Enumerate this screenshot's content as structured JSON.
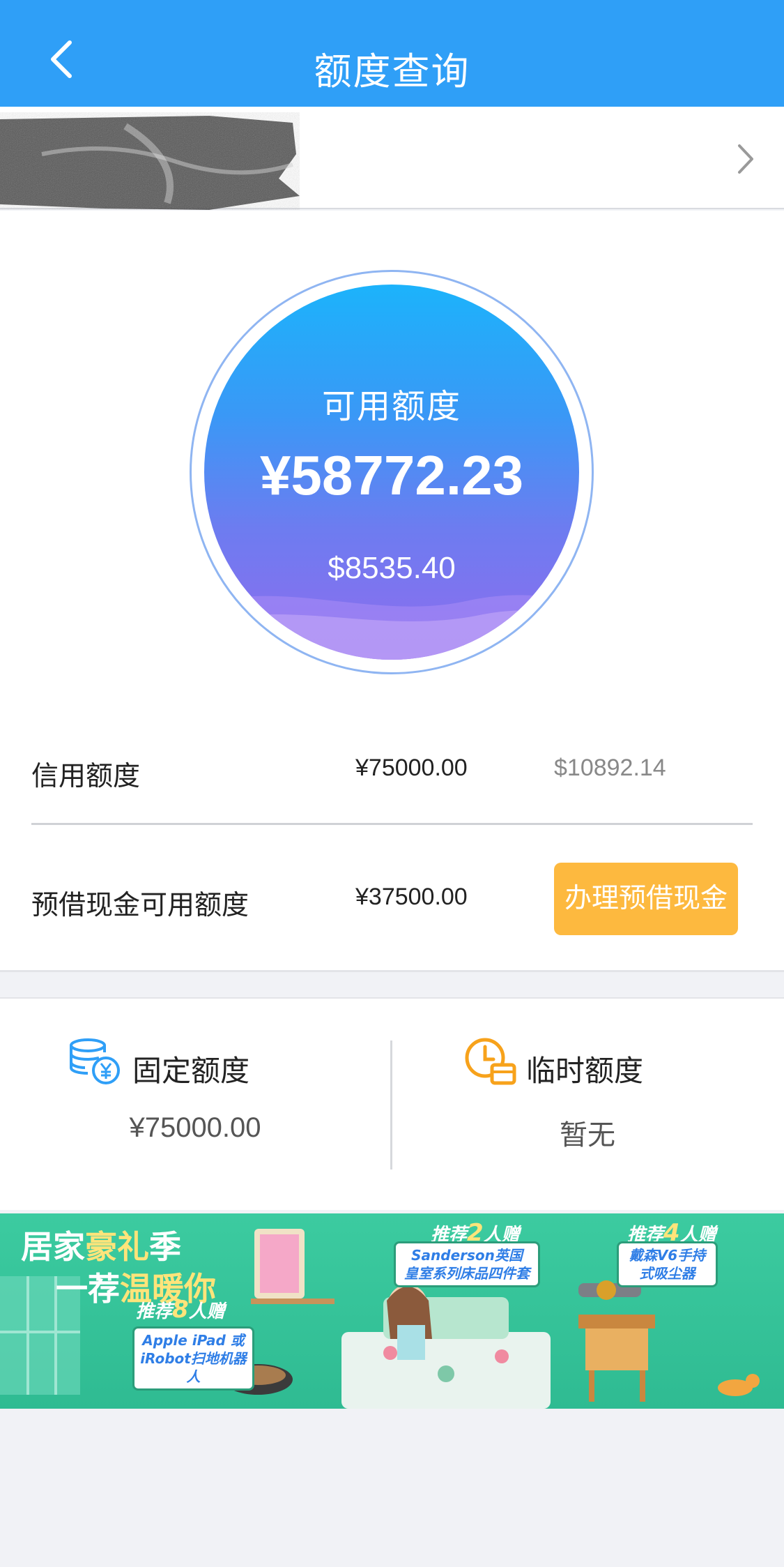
{
  "header": {
    "title": "额度查询"
  },
  "available": {
    "label": "可用额度",
    "cny": "¥58772.23",
    "usd": "$8535.40"
  },
  "credit": {
    "label": "信用额度",
    "cny": "¥75000.00",
    "usd": "$10892.14"
  },
  "cash_advance": {
    "label": "预借现金可用额度",
    "cny": "¥37500.00",
    "button": "办理预借现金"
  },
  "limits": {
    "fixed": {
      "label": "固定额度",
      "value": "¥75000.00"
    },
    "temporary": {
      "label": "临时额度",
      "value": "暂无"
    }
  },
  "banner": {
    "slogan_line1_a": "居家",
    "slogan_line1_b": "豪礼",
    "slogan_line1_c": "季",
    "slogan_line2_a": "一荐",
    "slogan_line2_b": "温暖你",
    "promo1": {
      "pre": "推荐",
      "num": "8",
      "post": "人赠",
      "gift_line1": "Apple iPad 或",
      "gift_line2": "iRobot扫地机器人"
    },
    "promo2": {
      "pre": "推荐",
      "num": "2",
      "post": "人赠",
      "gift_line1": "Sanderson英国",
      "gift_line2": "皇室系列床品四件套"
    },
    "promo3": {
      "pre": "推荐",
      "num": "4",
      "post": "人赠",
      "gift_line1": "戴森V6手持",
      "gift_line2": "式吸尘器"
    }
  },
  "icons": {
    "back": "chevron-left-icon",
    "forward": "chevron-right-icon",
    "fixed": "coins-yuan-icon",
    "temporary": "clock-card-icon"
  },
  "colors": {
    "header_bg": "#2f9ff7",
    "button_bg": "#fdb93f",
    "banner_bg": "#3ccba0"
  }
}
